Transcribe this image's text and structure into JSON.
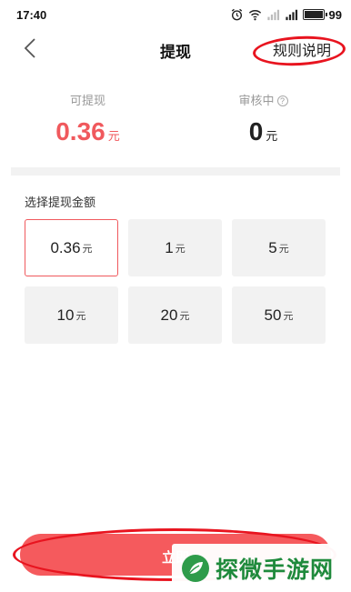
{
  "status_bar": {
    "time": "17:40",
    "battery": "99",
    "icons": [
      "alarm-icon",
      "wifi-icon",
      "signal-icon",
      "signal-icon",
      "battery-icon"
    ]
  },
  "nav": {
    "title": "提现",
    "rules_label": "规则说明",
    "back_icon": "chevron-left-icon"
  },
  "balances": {
    "withdrawable": {
      "label": "可提现",
      "value": "0.36",
      "unit": "元",
      "color": "#f0595d"
    },
    "reviewing": {
      "label": "审核中",
      "value": "0",
      "unit": "元",
      "help_icon": "?"
    }
  },
  "amounts": {
    "title": "选择提现金额",
    "unit": "元",
    "selected_index": 0,
    "options": [
      "0.36",
      "1",
      "5",
      "10",
      "20",
      "50"
    ]
  },
  "cta": {
    "label": "立即提现",
    "visible_label": "立即",
    "color": "#f55a5d"
  },
  "annotation": {
    "color": "#e8141f"
  },
  "watermark": {
    "text": "探微手游网",
    "logo_icon": "leaf-logo-icon",
    "color": "#1f8a3c"
  }
}
